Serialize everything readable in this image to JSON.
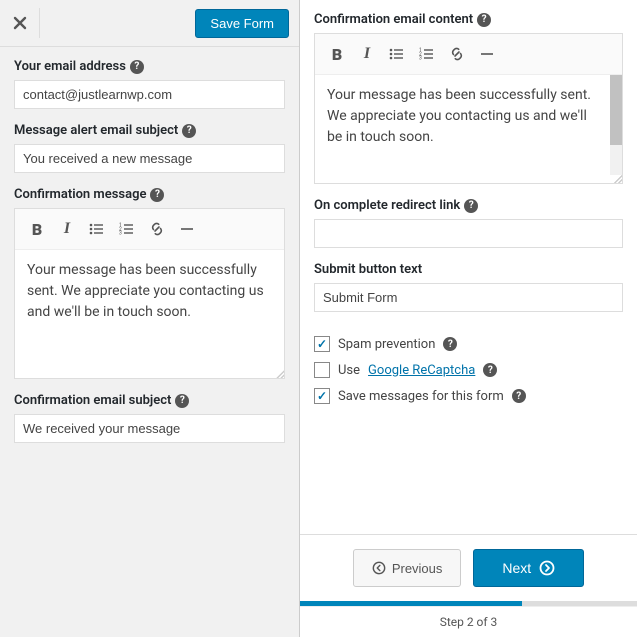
{
  "header": {
    "save_label": "Save Form"
  },
  "left": {
    "email_label": "Your email address",
    "email_value": "contact@justlearnwp.com",
    "subject_label": "Message alert email subject",
    "subject_value": "You received a new message",
    "confirm_msg_label": "Confirmation message",
    "confirm_msg_value": "Your message has been successfully sent. We appreciate you contacting us and we'll be in touch soon.",
    "confirm_subject_label": "Confirmation email subject",
    "confirm_subject_value": "We received your message"
  },
  "right": {
    "confirm_content_label": "Confirmation email content",
    "confirm_content_value": "Your message has been successfully sent. We appreciate you contacting us and we'll be in touch soon.",
    "redirect_label": "On complete redirect link",
    "redirect_value": "",
    "submit_label": "Submit button text",
    "submit_value": "Submit Form",
    "spam_label": "Spam prevention",
    "recaptcha_prefix": "Use",
    "recaptcha_link": "Google ReCaptcha",
    "save_msgs_label": "Save messages for this form"
  },
  "footer": {
    "prev_label": "Previous",
    "next_label": "Next",
    "step_text": "Step 2 of 3"
  },
  "icons": {
    "help": "?"
  }
}
